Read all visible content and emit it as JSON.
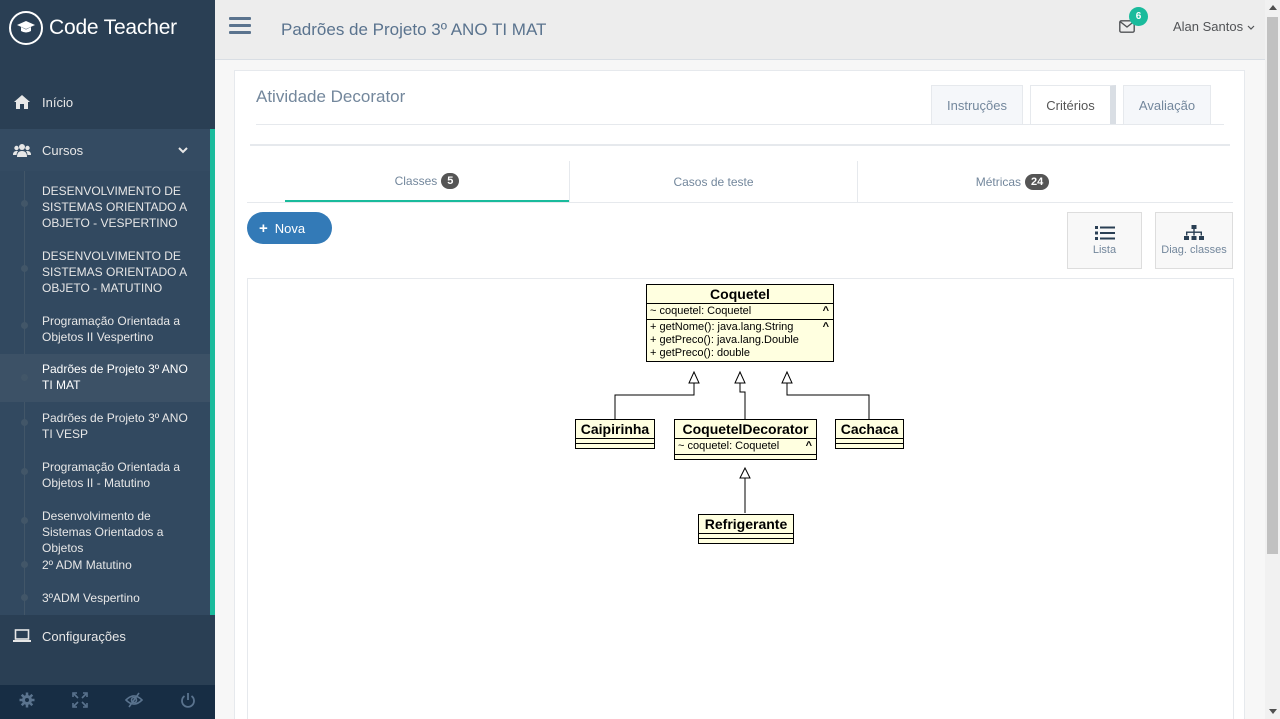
{
  "brand": {
    "title": "Code Teacher"
  },
  "sidebar": {
    "inicio": "Início",
    "cursos": "Cursos",
    "courses": [
      "DESENVOLVIMENTO DE SISTEMAS ORIENTADO A OBJETO - VESPERTINO",
      "DESENVOLVIMENTO DE SISTEMAS ORIENTADO A OBJETO - MATUTINO",
      "Programação Orientada a Objetos II Vespertino",
      "Padrões de Projeto 3º ANO TI MAT",
      "Padrões de Projeto 3º ANO TI VESP",
      "Programação Orientada a Objetos II - Matutino",
      "Desenvolvimento de Sistemas Orientados a Objetos",
      "2º ADM Matutino",
      "3ºADM Vespertino"
    ],
    "configuracoes": "Configurações"
  },
  "header": {
    "title": "Padrões de Projeto 3º ANO TI MAT",
    "mail_count": "6",
    "user": "Alan Santos"
  },
  "activity": {
    "title": "Atividade Decorator",
    "tabs": [
      "Instruções",
      "Critérios",
      "Avaliação"
    ],
    "content_tabs": {
      "classes": "Classes",
      "classes_count": "5",
      "casos": "Casos de teste",
      "metricas": "Métricas",
      "metricas_count": "24"
    },
    "nova": "Nova",
    "lista": "Lista",
    "diag": "Diag. classes"
  },
  "uml": {
    "coquetel": {
      "name": "Coquetel",
      "attribute": "~ coquetel: Coquetel",
      "methods": [
        "+ getNome(): java.lang.String",
        "+ getPreco(): java.lang.Double",
        "+ getPreco(): double"
      ]
    },
    "caipirinha": {
      "name": "Caipirinha"
    },
    "decorator": {
      "name": "CoquetelDecorator",
      "attribute": "~ coquetel: Coquetel"
    },
    "cachaca": {
      "name": "Cachaca"
    },
    "refrigerante": {
      "name": "Refrigerante"
    }
  },
  "colors": {
    "sidebar": "#2a3f54",
    "accent": "#1abb9c",
    "primary": "#337ab7",
    "uml_fill": "#ffffe0"
  }
}
